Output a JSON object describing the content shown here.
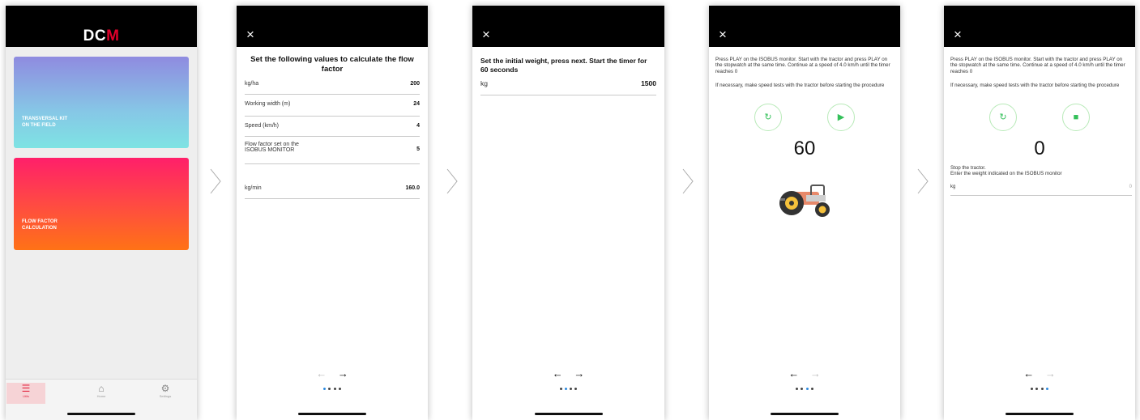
{
  "screen1": {
    "logo": {
      "part1": "DC",
      "part2": "M"
    },
    "cards": [
      {
        "label": "TRANSVERSAL KIT",
        "label2": "ON THE FIELD"
      },
      {
        "label": "FLOW FACTOR",
        "label2": "CALCULATION"
      }
    ],
    "tabs": [
      {
        "label": "Utils",
        "icon": "list-icon"
      },
      {
        "label": "Home",
        "icon": "home-icon"
      },
      {
        "label": "Settings",
        "icon": "gear-icon"
      }
    ]
  },
  "screen2": {
    "title": "Set the following values to calculate the flow factor",
    "rows": [
      {
        "label": "kg/ha",
        "value": "200"
      },
      {
        "label": "Working width  (m)",
        "value": "24"
      },
      {
        "label": "Speed  (km/h)",
        "value": "4"
      },
      {
        "label": "Flow factor set on the",
        "label2": "ISOBUS MONITOR",
        "value": "5"
      }
    ],
    "result": {
      "label": "kg/min",
      "value": "160.0"
    }
  },
  "screen3": {
    "title": "Set the initial weight, press next. Start the timer for 60 seconds",
    "row": {
      "label": "kg",
      "value": "1500"
    }
  },
  "screen4": {
    "instructions": "Press PLAY on the ISOBUS monitor. Start with the tractor and press PLAY on the stopwatch at the same time. Continue at a speed of 4.0 km/h until the timer reaches 0",
    "note": "If necessary, make speed tests with the tractor before starting the procedure",
    "timer": "60"
  },
  "screen5": {
    "instructions": "Press PLAY on the ISOBUS monitor. Start with the tractor and press PLAY on the stopwatch at the same time. Continue at a speed of 4.0 km/h until the timer reaches 0",
    "note": "If necessary, make speed tests with the tractor before starting the procedure",
    "timer": "0",
    "stop_text": "Stop the tractor.",
    "enter_text": "Enter the weight indicated on the ISOBUS monitor",
    "field": {
      "label": "kg",
      "value": "0"
    }
  },
  "nav": {
    "back": "←",
    "next": "→",
    "close": "×"
  },
  "colors": {
    "accent_green": "#34c05a",
    "active_tab": "#e32a44",
    "dot_active": "#2c8ae0"
  }
}
